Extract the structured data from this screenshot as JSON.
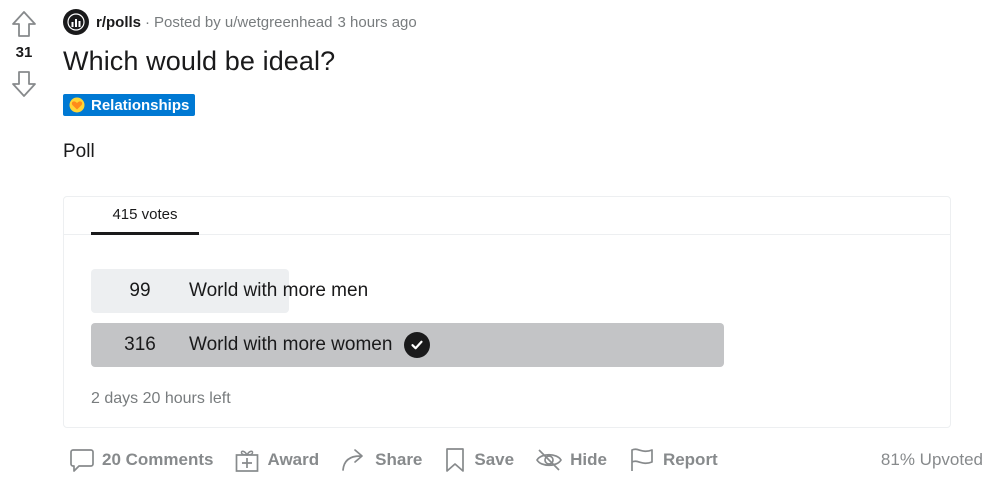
{
  "post": {
    "score": "31",
    "subreddit": "r/polls",
    "posted_by_prefix": "Posted by",
    "author": "u/wetgreenhead",
    "time_ago": "3 hours ago",
    "title": "Which would be ideal?",
    "flair": "Relationships",
    "body": "Poll"
  },
  "poll": {
    "votes_tab": "415 votes",
    "options": [
      {
        "count": "99",
        "label": "World with more men",
        "fraction": 0.313,
        "selected": false
      },
      {
        "count": "316",
        "label": "World with more women",
        "fraction": 1.0,
        "selected": true
      }
    ],
    "time_left": "2 days 20 hours left"
  },
  "actions": {
    "comments": "20 Comments",
    "award": "Award",
    "share": "Share",
    "save": "Save",
    "hide": "Hide",
    "report": "Report"
  },
  "upvoted": "81% Upvoted",
  "colors": {
    "flair_bg": "#0079d3",
    "bar_unselected": "#edeff1",
    "bar_selected": "#c3c4c6",
    "meta_gray": "#787c7e"
  }
}
